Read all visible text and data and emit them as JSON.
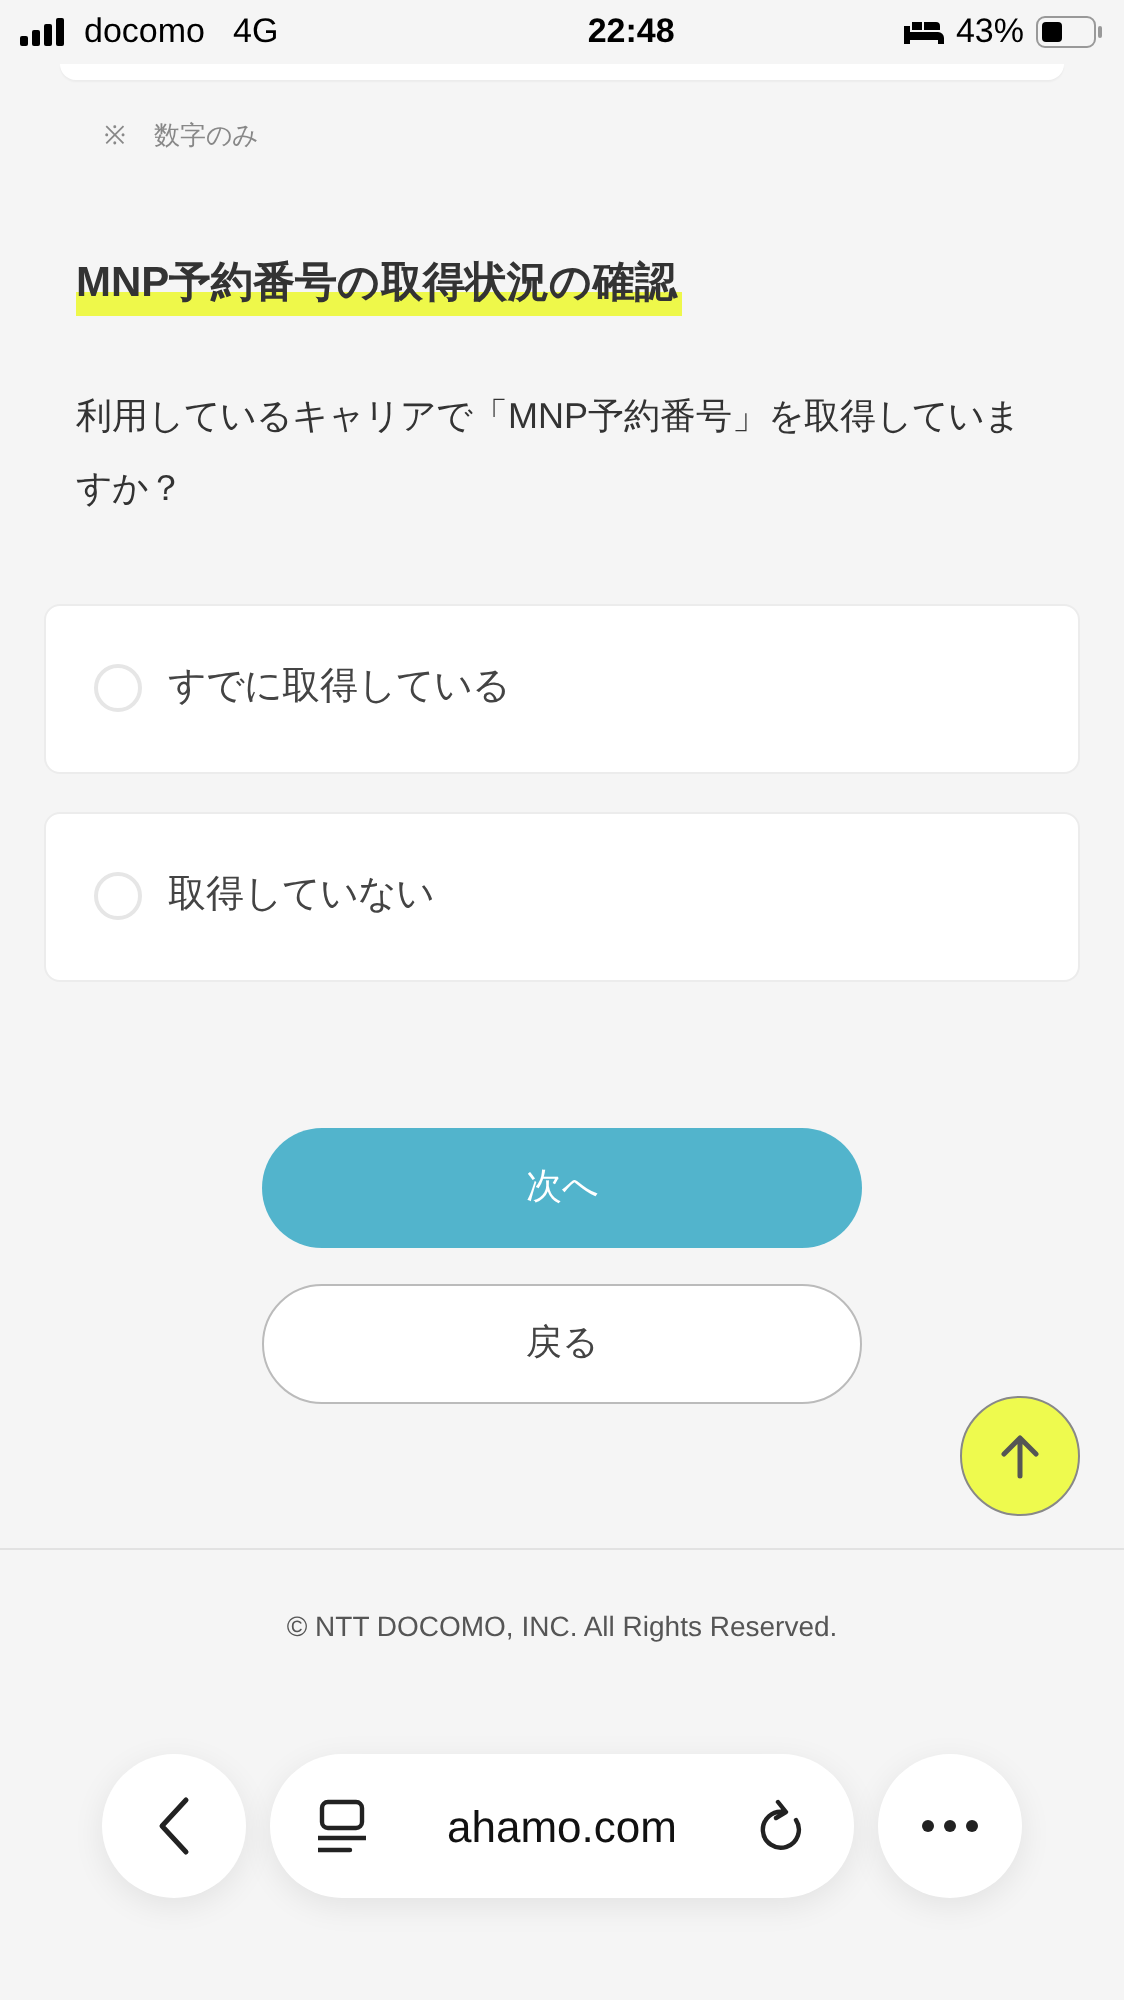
{
  "status_bar": {
    "carrier": "docomo",
    "network": "4G",
    "time": "22:48",
    "battery": "43%"
  },
  "note": {
    "mark": "※",
    "text": "数字のみ"
  },
  "section": {
    "title": "MNP予約番号の取得状況の確認",
    "question": "利用しているキャリアで「MNP予約番号」を取得していますか？"
  },
  "options": [
    {
      "label": "すでに取得している",
      "selected": false
    },
    {
      "label": "取得していない",
      "selected": false
    }
  ],
  "buttons": {
    "next": "次へ",
    "back": "戻る"
  },
  "footer": {
    "copyright": "© NTT DOCOMO, INC. All Rights Reserved."
  },
  "browser_bar": {
    "url": "ahamo.com"
  }
}
